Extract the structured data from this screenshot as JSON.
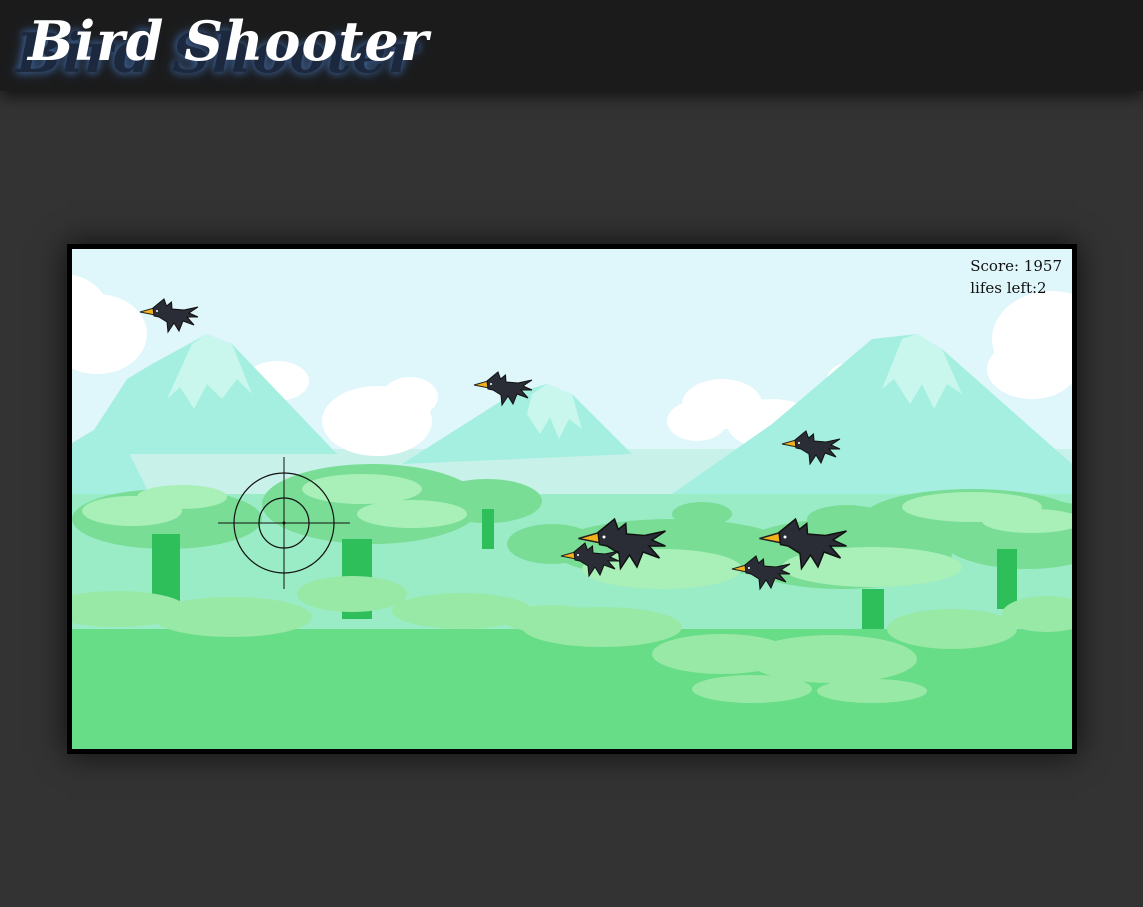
{
  "header": {
    "title": "Bird Shooter"
  },
  "hud": {
    "score_label": "Score: 1957",
    "lives_label": "lifes left:2"
  },
  "colors": {
    "page_background": "#333333",
    "header_background": "#1b1b1b",
    "sky": "#dff6fb",
    "grass": "#6ade8a",
    "bird_body": "#2a2d35",
    "bird_beak": "#f3b21b"
  },
  "icons": {
    "crosshair": "crosshair-icon",
    "bird": "crow-bird-icon"
  }
}
